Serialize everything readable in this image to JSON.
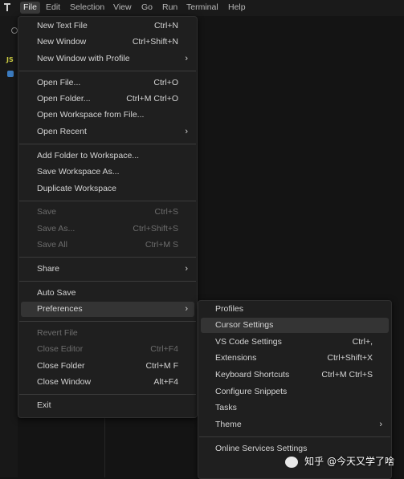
{
  "menubar": {
    "items": [
      "File",
      "Edit",
      "Selection",
      "View",
      "Go",
      "Run",
      "Terminal",
      "Help"
    ]
  },
  "activity_bar": {
    "glyphs": [
      "JS"
    ]
  },
  "file_menu": {
    "items": [
      {
        "label": "New Text File",
        "shortcut": "Ctrl+N"
      },
      {
        "label": "New Window",
        "shortcut": "Ctrl+Shift+N"
      },
      {
        "label": "New Window with Profile",
        "shortcut": "",
        "submenu": true
      },
      {
        "label": "Open File...",
        "shortcut": "Ctrl+O"
      },
      {
        "label": "Open Folder...",
        "shortcut": "Ctrl+M Ctrl+O"
      },
      {
        "label": "Open Workspace from File...",
        "shortcut": ""
      },
      {
        "label": "Open Recent",
        "shortcut": "",
        "submenu": true
      },
      {
        "label": "Add Folder to Workspace...",
        "shortcut": ""
      },
      {
        "label": "Save Workspace As...",
        "shortcut": ""
      },
      {
        "label": "Duplicate Workspace",
        "shortcut": ""
      },
      {
        "label": "Save",
        "shortcut": "Ctrl+S",
        "disabled": true
      },
      {
        "label": "Save As...",
        "shortcut": "Ctrl+Shift+S",
        "disabled": true
      },
      {
        "label": "Save All",
        "shortcut": "Ctrl+M S",
        "disabled": true
      },
      {
        "label": "Share",
        "shortcut": "",
        "submenu": true
      },
      {
        "label": "Auto Save",
        "shortcut": ""
      },
      {
        "label": "Preferences",
        "shortcut": "",
        "submenu": true,
        "highlighted": true
      },
      {
        "label": "Revert File",
        "shortcut": "",
        "disabled": true
      },
      {
        "label": "Close Editor",
        "shortcut": "Ctrl+F4",
        "disabled": true
      },
      {
        "label": "Close Folder",
        "shortcut": "Ctrl+M F"
      },
      {
        "label": "Close Window",
        "shortcut": "Alt+F4"
      },
      {
        "label": "Exit",
        "shortcut": ""
      }
    ]
  },
  "preferences_menu": {
    "items": [
      {
        "label": "Profiles",
        "shortcut": ""
      },
      {
        "label": "Cursor Settings",
        "shortcut": "",
        "highlighted": true
      },
      {
        "label": "VS Code Settings",
        "shortcut": "Ctrl+,"
      },
      {
        "label": "Extensions",
        "shortcut": "Ctrl+Shift+X"
      },
      {
        "label": "Keyboard Shortcuts",
        "shortcut": "Ctrl+M Ctrl+S"
      },
      {
        "label": "Configure Snippets",
        "shortcut": ""
      },
      {
        "label": "Tasks",
        "shortcut": ""
      },
      {
        "label": "Theme",
        "shortcut": "",
        "submenu": true
      },
      {
        "label": "Online Services Settings",
        "shortcut": ""
      }
    ]
  },
  "watermark": {
    "text": "知乎 @今天又学了啥"
  },
  "colors": {
    "menu_bg": "#1f1f1f",
    "highlight_bg": "#343434",
    "disabled_text": "#6d6d6d",
    "text": "#d4d4d4",
    "js_yellow": "#cbcb41",
    "python_blue": "#3b7bbf"
  },
  "icons": {
    "app": "cursor-app-icon",
    "submenu_arrow": "chevron-right-icon"
  }
}
